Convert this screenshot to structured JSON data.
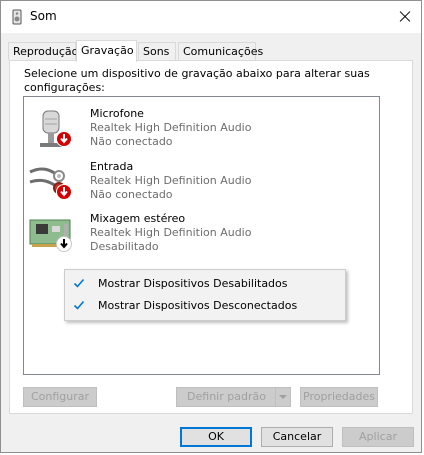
{
  "window": {
    "title": "Som",
    "close_icon": "close-icon",
    "app_icon": "speaker-icon"
  },
  "tabs": [
    {
      "label": "Reprodução",
      "active": false
    },
    {
      "label": "Gravação",
      "active": true
    },
    {
      "label": "Sons",
      "active": false
    },
    {
      "label": "Comunicações",
      "active": false
    }
  ],
  "panel": {
    "instruction": "Selecione um dispositivo de gravação abaixo para alterar suas configurações:"
  },
  "devices": [
    {
      "name": "Microfone",
      "driver": "Realtek High Definition Audio",
      "status": "Não conectado",
      "icon": "microphone-icon",
      "badge": "disconnected-badge-icon"
    },
    {
      "name": "Entrada",
      "driver": "Realtek High Definition Audio",
      "status": "Não conectado",
      "icon": "line-in-cable-icon",
      "badge": "disconnected-badge-icon"
    },
    {
      "name": "Mixagem estéreo",
      "driver": "Realtek High Definition Audio",
      "status": "Desabilitado",
      "icon": "sound-card-icon",
      "badge": "disabled-badge-icon"
    }
  ],
  "context_menu": {
    "items": [
      {
        "label": "Mostrar Dispositivos Desabilitados",
        "checked": true
      },
      {
        "label": "Mostrar Dispositivos Desconectados",
        "checked": true
      }
    ]
  },
  "buttons": {
    "configure": "Configurar",
    "set_default": "Definir padrão",
    "properties": "Propriedades",
    "ok": "OK",
    "cancel": "Cancelar",
    "apply": "Aplicar"
  },
  "colors": {
    "accent": "#0078d7",
    "badge_red": "#d40000",
    "disabled_text": "#a0a0a0"
  }
}
